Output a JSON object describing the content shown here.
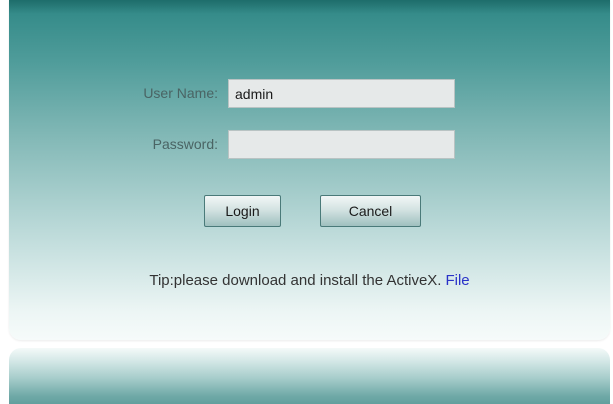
{
  "login": {
    "username_label": "User Name:",
    "username_value": "admin",
    "password_label": "Password:",
    "password_value": "",
    "login_button": "Login",
    "cancel_button": "Cancel"
  },
  "tip": {
    "text": "Tip:please download and install the ActiveX.",
    "link": "File"
  },
  "colors": {
    "panel_top": "#2e8785",
    "panel_bottom": "#f6fbfa",
    "link": "#2a32c8"
  }
}
